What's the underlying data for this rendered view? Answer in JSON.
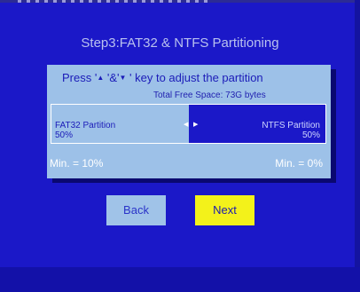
{
  "title": "Step3:FAT32 & NTFS Partitioning",
  "instruction": {
    "prefix": "Press '",
    "up_symbol": "▲",
    "middle": " '&'",
    "down_symbol": "▼",
    "suffix": " ' key to adjust the partition"
  },
  "free_space": "Total Free Space: 73G bytes",
  "partition": {
    "fat32_label": "FAT32 Partition",
    "fat32_percent": "50%",
    "ntfs_label": "NTFS Partition",
    "ntfs_percent": "50%",
    "split_fraction": 0.5,
    "handle_left": "◀",
    "handle_right": "▶"
  },
  "min_fat32": "Min. = 10%",
  "min_ntfs": "Min. = 0%",
  "buttons": {
    "back": "Back",
    "next": "Next"
  },
  "colors": {
    "background": "#1b18c8",
    "panel": "#9dc1e8",
    "next_highlight": "#f3f21a"
  }
}
